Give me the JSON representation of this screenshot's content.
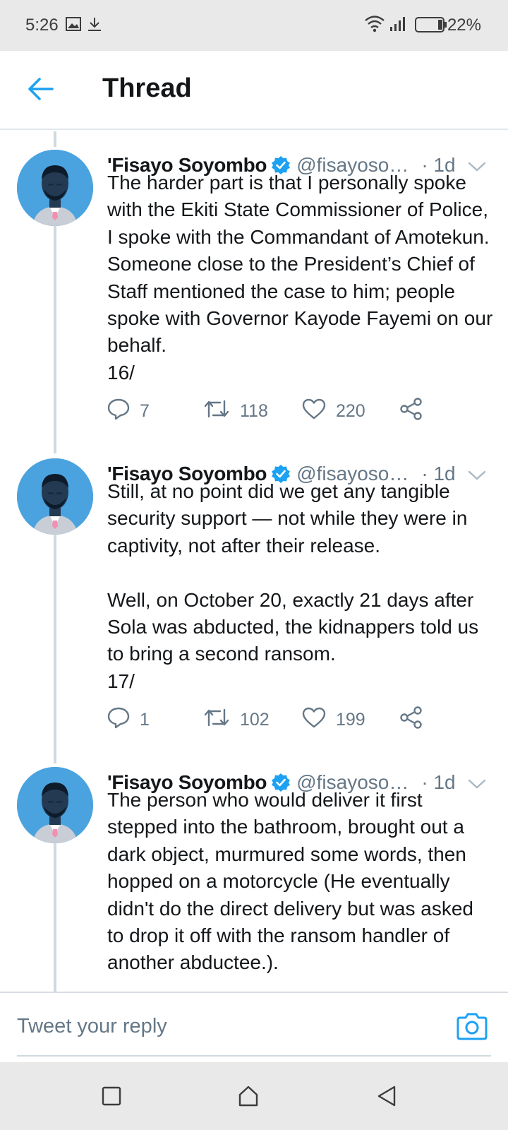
{
  "status_bar": {
    "time": "5:26",
    "battery_percent": "22%",
    "icons": [
      "gallery-icon",
      "download-icon",
      "wifi-icon",
      "signal-icon",
      "battery-icon"
    ]
  },
  "header": {
    "title": "Thread",
    "back_icon": "back-arrow-icon"
  },
  "tweets": [
    {
      "display_name": "'Fisayo Soyombo",
      "handle": "@fisayoso…",
      "time": "· 1d",
      "text": "The harder part is that I personally spoke with the Ekiti State Commissioner of Police, I spoke with the Commandant of Amotekun. Someone close to the President’s Chief of Staff mentioned the case to him; people spoke with Governor Kayode Fayemi on our behalf.\n16/",
      "replies": "7",
      "retweets": "118",
      "likes": "220"
    },
    {
      "display_name": "'Fisayo Soyombo",
      "handle": "@fisayoso…",
      "time": "· 1d",
      "text": "Still, at no point did we get any tangible security support — not while they were in captivity, not after their release.\n\nWell, on October 20, exactly 21 days after Sola was abducted, the kidnappers told us to bring a second ransom.\n17/",
      "replies": "1",
      "retweets": "102",
      "likes": "199"
    },
    {
      "display_name": "'Fisayo Soyombo",
      "handle": "@fisayoso…",
      "time": "· 1d",
      "text": "The person who would deliver it first stepped into the bathroom, brought out a dark object, murmured some words, then hopped on a motorcycle (He eventually didn't do the direct delivery but was asked to drop it off with the ransom handler of another abductee.).",
      "replies": "",
      "retweets": "",
      "likes": ""
    }
  ],
  "reply": {
    "placeholder": "Tweet your reply",
    "camera_icon": "camera-icon"
  },
  "nav_bar": {
    "icons": [
      "recents-icon",
      "home-icon",
      "back-triangle-icon"
    ]
  },
  "colors": {
    "accent": "#1da1f2",
    "secondary_text": "#657786",
    "primary_text": "#14171a",
    "avatar_bg": "#4aa3df",
    "status_bar_bg": "#e9e9e9"
  }
}
